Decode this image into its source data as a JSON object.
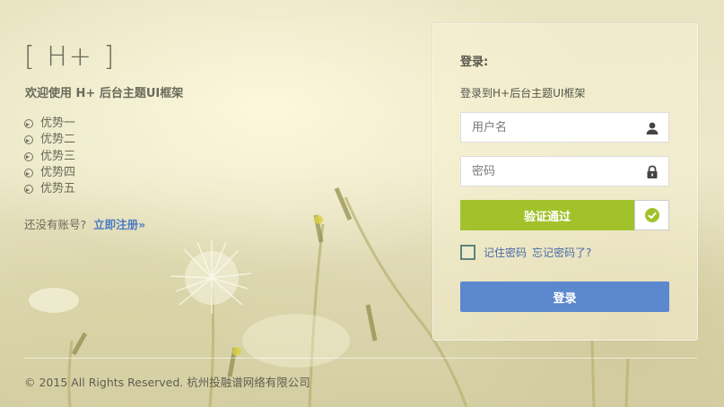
{
  "left": {
    "logo": "[ H+ ]",
    "welcome": "欢迎使用 H+ 后台主题UI框架",
    "advantages": [
      "优势一",
      "优势二",
      "优势三",
      "优势四",
      "优势五"
    ],
    "no_account": "还没有账号?",
    "register_link": "立即注册»"
  },
  "login": {
    "title": "登录:",
    "subtitle": "登录到H+后台主题UI框架",
    "username_placeholder": "用户名",
    "password_placeholder": "密码",
    "verify_label": "验证通过",
    "remember_label": "记住密码",
    "forgot_label": "忘记密码了?",
    "submit_label": "登录"
  },
  "footer": {
    "text": "© 2015 All Rights Reserved. 杭州投融谱网络有限公司"
  },
  "colors": {
    "verify_green": "#a2c22c",
    "login_blue": "#5b88cf",
    "link_blue": "#4a7bc4"
  },
  "icons": {
    "advantage": "circle-arrow-right-icon",
    "username": "user-icon",
    "password": "lock-icon",
    "verified": "check-circle-icon"
  }
}
